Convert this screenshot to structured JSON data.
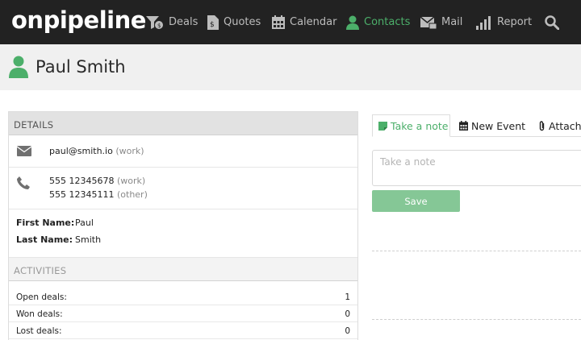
{
  "app": {
    "logo": "onpipeline"
  },
  "nav": {
    "items": [
      {
        "label": "Deals",
        "icon": "deals-funnel-icon"
      },
      {
        "label": "Quotes",
        "icon": "quote-document-icon"
      },
      {
        "label": "Calendar",
        "icon": "calendar-icon"
      },
      {
        "label": "Contacts",
        "icon": "person-icon",
        "active": true
      },
      {
        "label": "Mail",
        "icon": "mail-icon"
      },
      {
        "label": "Report",
        "icon": "bar-chart-icon"
      }
    ],
    "search_icon": "search-icon"
  },
  "contact": {
    "name": "Paul Smith"
  },
  "details": {
    "heading": "DETAILS",
    "email": {
      "value": "paul@smith.io",
      "type": "(work)"
    },
    "phones": [
      {
        "value": "555 12345678",
        "type": "(work)"
      },
      {
        "value": "555 12345111",
        "type": "(other)"
      }
    ],
    "first_name_label": "First Name:",
    "first_name": "Paul",
    "last_name_label": "Last Name:",
    "last_name": "Smith"
  },
  "activities": {
    "heading": "ACTIVITIES",
    "rows": [
      {
        "label": "Open deals:",
        "value": "1"
      },
      {
        "label": "Won deals:",
        "value": "0"
      },
      {
        "label": "Lost deals:",
        "value": "0"
      }
    ]
  },
  "composer": {
    "tabs": [
      {
        "label": "Take a note",
        "icon": "note-icon",
        "active": true
      },
      {
        "label": "New Event",
        "icon": "calendar-icon"
      },
      {
        "label": "Attach",
        "icon": "paperclip-icon"
      }
    ],
    "note_placeholder": "Take a note",
    "save_label": "Save"
  },
  "colors": {
    "accent": "#4caf6a",
    "nav_bg": "#222222",
    "save_button": "#85c796"
  }
}
